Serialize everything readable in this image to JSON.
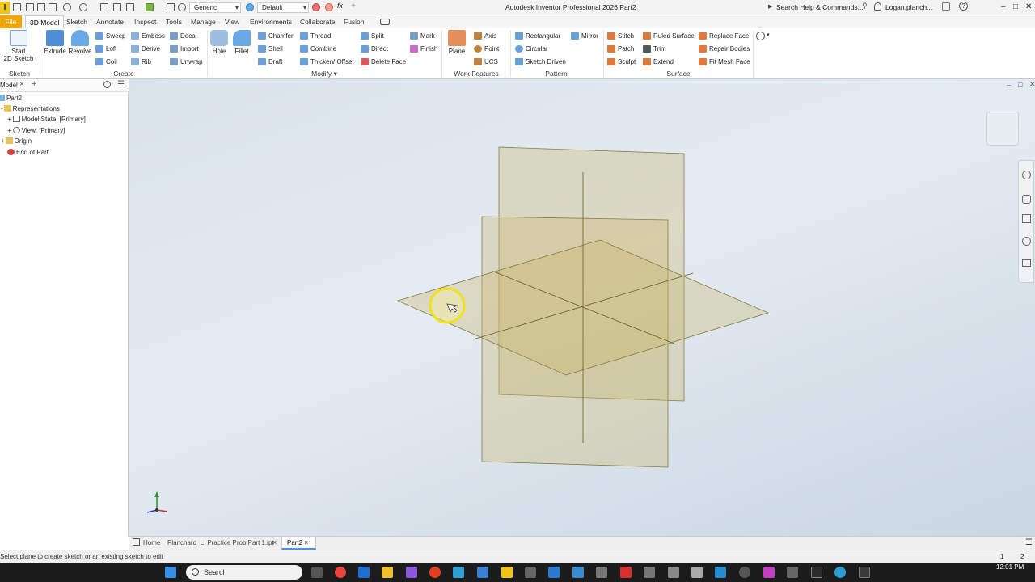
{
  "titlebar": {
    "app_title": "Autodesk Inventor Professional 2026   Part2",
    "appearance_dropdown": "Generic",
    "material_dropdown": "Default",
    "search_help": "Search Help & Commands...",
    "user": "Logan.planch..."
  },
  "tabs": [
    "File",
    "3D Model",
    "Sketch",
    "Annotate",
    "Inspect",
    "Tools",
    "Manage",
    "View",
    "Environments",
    "Collaborate",
    "Fusion"
  ],
  "ribbon": {
    "sketch": {
      "start_2d_sketch": "Start\n2D Sketch",
      "panel": "Sketch"
    },
    "create": {
      "extrude": "Extrude",
      "revolve": "Revolve",
      "sweep": "Sweep",
      "emboss": "Emboss",
      "decal": "Decal",
      "loft": "Loft",
      "derive": "Derive",
      "import": "Import",
      "coil": "Coil",
      "rib": "Rib",
      "unwrap": "Unwrap",
      "panel": "Create"
    },
    "modify": {
      "hole": "Hole",
      "fillet": "Fillet",
      "chamfer": "Chamfer",
      "thread": "Thread",
      "split": "Split",
      "mark": "Mark",
      "shell": "Shell",
      "combine": "Combine",
      "direct": "Direct",
      "finish": "Finish",
      "draft": "Draft",
      "thicken_offset": "Thicken/ Offset",
      "delete_face": "Delete Face",
      "panel": "Modify"
    },
    "work_features": {
      "plane": "Plane",
      "axis": "Axis",
      "point": "Point",
      "ucs": "UCS",
      "panel": "Work Features"
    },
    "pattern": {
      "rectangular": "Rectangular",
      "mirror": "Mirror",
      "circular": "Circular",
      "sketch_driven": "Sketch Driven",
      "panel": "Pattern"
    },
    "surface": {
      "stitch": "Stitch",
      "ruled_surface": "Ruled Surface",
      "replace_face": "Replace Face",
      "patch": "Patch",
      "trim": "Trim",
      "repair_bodies": "Repair Bodies",
      "sculpt": "Sculpt",
      "extend": "Extend",
      "fit_mesh_face": "Fit Mesh Face",
      "panel": "Surface"
    }
  },
  "browser": {
    "tab": "Model",
    "root": "Part2",
    "items": [
      "Representations",
      "Model State: [Primary]",
      "View: [Primary]",
      "Origin",
      "End of Part"
    ]
  },
  "doc_tabs": {
    "home": "Home",
    "file1": "Planchard_L_Practice Prob Part 1.ipt",
    "file2": "Part2"
  },
  "status": {
    "message": "Select plane to create sketch or an existing sketch to edit",
    "count1": "1",
    "count2": "2"
  },
  "taskbar": {
    "search": "Search",
    "time": "12:01 PM"
  },
  "colors": {
    "accent": "#f0a500",
    "plane_fill": "#c8b870",
    "viewport_top": "#d9e3ec"
  }
}
